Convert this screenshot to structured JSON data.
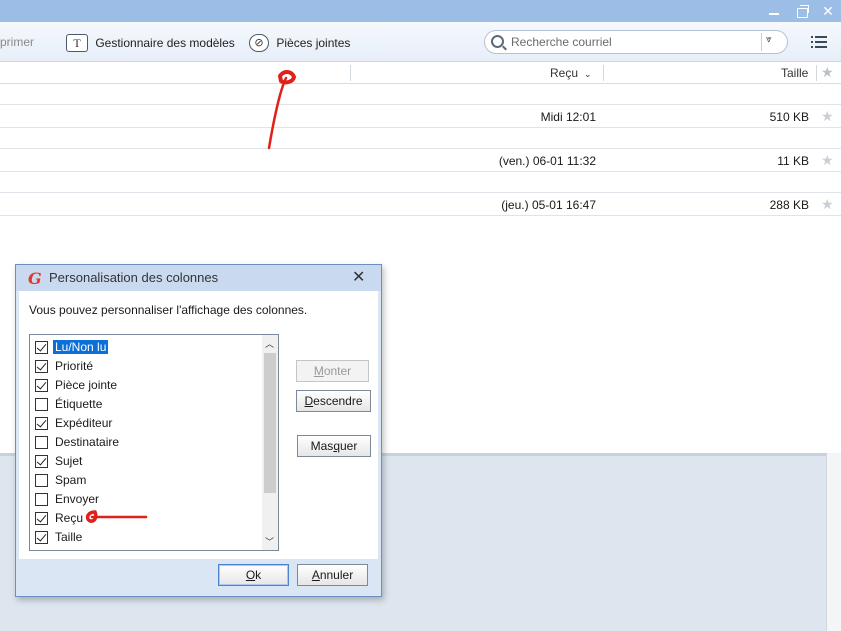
{
  "toolbar": {
    "print_label": "primer",
    "templates_label": "Gestionnaire des modèles",
    "attachments_label": "Pièces jointes"
  },
  "search": {
    "placeholder": "Recherche courriel"
  },
  "columns": {
    "received": "Reçu",
    "size": "Taille"
  },
  "emails": [
    {
      "received": "Midi 12:01",
      "size": "510 KB"
    },
    {
      "received": "(ven.) 06-01 11:32",
      "size": "11 KB"
    },
    {
      "received": "(jeu.) 05-01 16:47",
      "size": "288 KB"
    }
  ],
  "dialog": {
    "title": "Personalisation des colonnes",
    "description": "Vous pouvez personnaliser l'affichage des colonnes.",
    "columns": [
      {
        "label": "Lu/Non lu",
        "checked": true,
        "selected": true
      },
      {
        "label": "Priorité",
        "checked": true
      },
      {
        "label": "Pièce jointe",
        "checked": true
      },
      {
        "label": "Étiquette",
        "checked": false
      },
      {
        "label": "Expéditeur",
        "checked": true
      },
      {
        "label": "Destinataire",
        "checked": false
      },
      {
        "label": "Sujet",
        "checked": true
      },
      {
        "label": "Spam",
        "checked": false
      },
      {
        "label": "Envoyer",
        "checked": false
      },
      {
        "label": "Reçu",
        "checked": true
      },
      {
        "label": "Taille",
        "checked": true
      }
    ],
    "buttons": {
      "up": {
        "pre": "",
        "key": "M",
        "post": "onter"
      },
      "down": {
        "pre": "",
        "key": "D",
        "post": "escendre"
      },
      "hide": {
        "pre": "Mas",
        "key": "q",
        "post": "uer"
      },
      "ok": {
        "pre": "",
        "key": "O",
        "post": "k"
      },
      "cancel": {
        "pre": "",
        "key": "A",
        "post": "nnuler"
      }
    }
  },
  "colors": {
    "annotation": "#e0201a",
    "selection": "#0a6fd8",
    "titlebar": "#9bbde6"
  }
}
